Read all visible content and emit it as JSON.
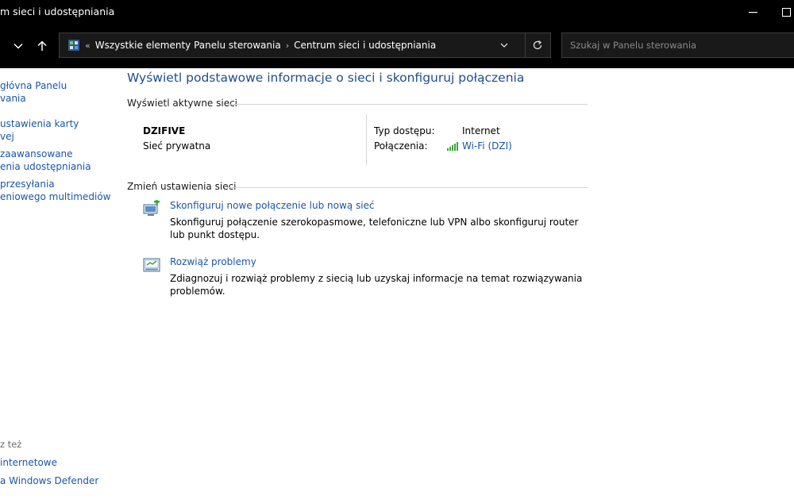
{
  "window": {
    "title": "m sieci i udostępniania"
  },
  "address_bar": {
    "chevron": "«",
    "crumbs": [
      "Wszystkie elementy Panelu sterowania",
      "Centrum sieci i udostępniania"
    ],
    "separator": "›"
  },
  "search": {
    "placeholder": "Szukaj w Panelu sterowania"
  },
  "sidebar": {
    "items": [
      "głóvna Panelu\nvania",
      "ustawienia karty\nvej",
      "zaawansowane\nenia udostępniania",
      "przesyłania\neniowego multimediów"
    ],
    "see_also_label": "z też",
    "see_also": [
      "internetowe",
      "a Windows Defender"
    ]
  },
  "main": {
    "title": "Wyświetl podstawowe informacje o sieci i skonfiguruj połączenia",
    "active_networks_heading": "Wyświetl aktywne sieci",
    "network": {
      "name": "DZIFIVE",
      "type": "Sieć prywatna",
      "access_type_label": "Typ dostępu:",
      "access_type_value": "Internet",
      "connections_label": "Połączenia:",
      "connections_value": "Wi-Fi (DZI)"
    },
    "change_settings_heading": "Zmień ustawienia sieci",
    "tasks": [
      {
        "link": "Skonfiguruj nowe połączenie lub nową sieć",
        "description": "Skonfiguruj połączenie szerokopasmowe, telefoniczne lub VPN albo skonfiguruj router lub punkt dostępu."
      },
      {
        "link": "Rozwiąż problemy",
        "description": "Zdiagnozuj i rozwiąż problemy z siecią lub uzyskaj informacje na temat rozwiązywania problemów."
      }
    ]
  },
  "colors": {
    "link": "#1a56a8",
    "title": "#1e4e8c",
    "chrome": "#000000",
    "signal": "#3aa63a"
  }
}
